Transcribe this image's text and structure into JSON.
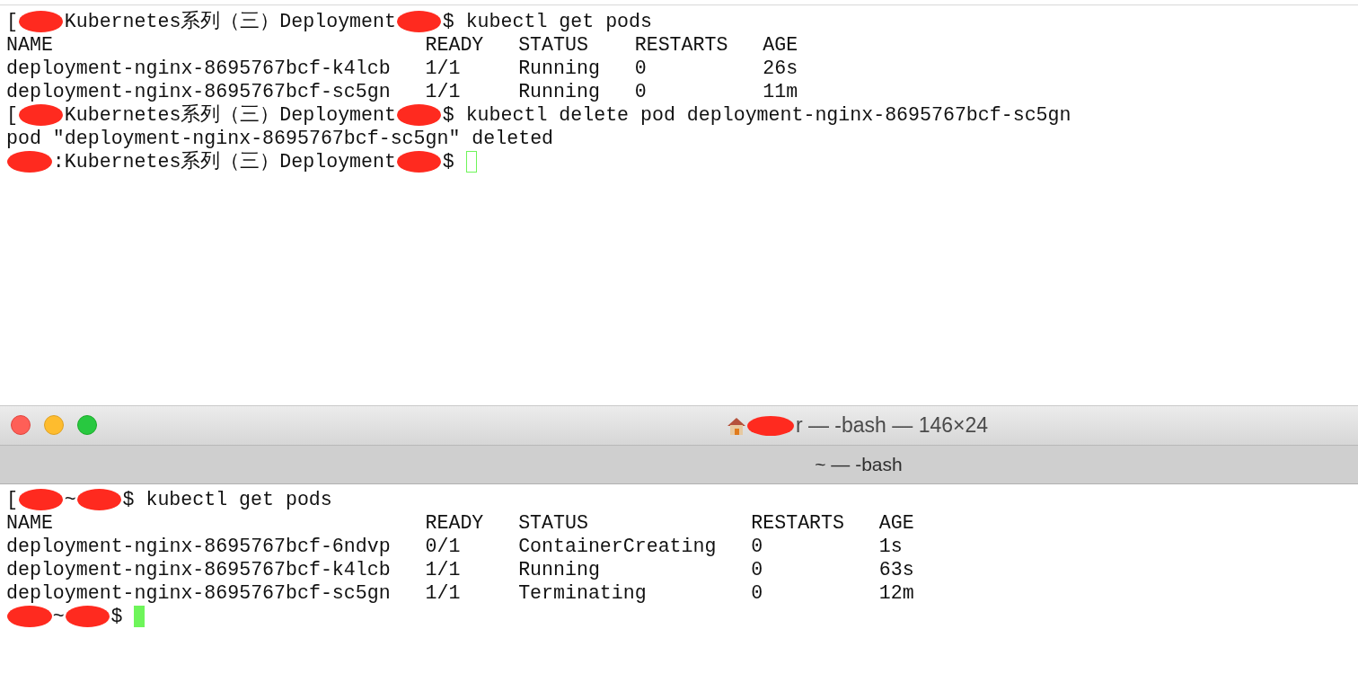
{
  "top_terminal": {
    "lines": [
      {
        "kind": "prompt",
        "parts": [
          {
            "kind": "text",
            "text": "["
          },
          {
            "kind": "redaction"
          },
          {
            "kind": "text",
            "text": "Kubernetes系列（三）Deployment"
          },
          {
            "kind": "redaction"
          },
          {
            "kind": "text",
            "text": "$"
          }
        ],
        "command": "kubectl get pods"
      },
      {
        "kind": "table",
        "columns": [
          "NAME",
          "READY",
          "STATUS",
          "RESTARTS",
          "AGE"
        ],
        "rows": [
          [
            "deployment-nginx-8695767bcf-k4lcb",
            "1/1",
            "Running",
            "0",
            "26s"
          ],
          [
            "deployment-nginx-8695767bcf-sc5gn",
            "1/1",
            "Running",
            "0",
            "11m"
          ]
        ]
      },
      {
        "kind": "prompt",
        "parts": [
          {
            "kind": "text",
            "text": "["
          },
          {
            "kind": "redaction"
          },
          {
            "kind": "text",
            "text": "Kubernetes系列（三）Deployment"
          },
          {
            "kind": "redaction"
          },
          {
            "kind": "text",
            "text": "$"
          }
        ],
        "command": "kubectl delete pod deployment-nginx-8695767bcf-sc5gn"
      },
      {
        "kind": "output",
        "text": "pod \"deployment-nginx-8695767bcf-sc5gn\" deleted"
      },
      {
        "kind": "prompt",
        "parts": [
          {
            "kind": "redaction"
          },
          {
            "kind": "text",
            "text": ":Kubernetes系列（三）Deployment"
          },
          {
            "kind": "redaction"
          },
          {
            "kind": "text",
            "text": "$"
          }
        ],
        "cursor": {
          "focused": false
        }
      }
    ]
  },
  "bottom_terminal": {
    "title_parts": [
      {
        "kind": "redaction"
      },
      {
        "kind": "text",
        "text": "r — -bash — 146×24"
      }
    ],
    "tab": "~ — -bash",
    "lines": [
      {
        "kind": "prompt",
        "parts": [
          {
            "kind": "text",
            "text": "["
          },
          {
            "kind": "redaction"
          },
          {
            "kind": "text",
            "text": "~"
          },
          {
            "kind": "redaction"
          },
          {
            "kind": "text",
            "text": "$"
          }
        ],
        "command": "kubectl get pods"
      },
      {
        "kind": "table",
        "columns": [
          "NAME",
          "READY",
          "STATUS",
          "RESTARTS",
          "AGE"
        ],
        "rows": [
          [
            "deployment-nginx-8695767bcf-6ndvp",
            "0/1",
            "ContainerCreating",
            "0",
            "1s"
          ],
          [
            "deployment-nginx-8695767bcf-k4lcb",
            "1/1",
            "Running",
            "0",
            "63s"
          ],
          [
            "deployment-nginx-8695767bcf-sc5gn",
            "1/1",
            "Terminating",
            "0",
            "12m"
          ]
        ]
      },
      {
        "kind": "prompt",
        "parts": [
          {
            "kind": "redaction"
          },
          {
            "kind": "text",
            "text": "~"
          },
          {
            "kind": "redaction"
          },
          {
            "kind": "text",
            "text": "$"
          }
        ],
        "cursor": {
          "focused": true
        }
      }
    ]
  }
}
